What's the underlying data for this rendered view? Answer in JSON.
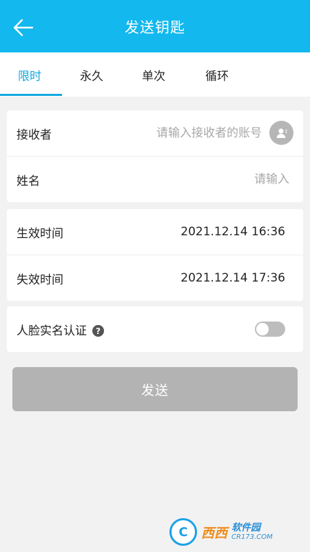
{
  "header": {
    "title": "发送钥匙"
  },
  "tabs": [
    {
      "label": "限时",
      "active": true
    },
    {
      "label": "永久",
      "active": false
    },
    {
      "label": "单次",
      "active": false
    },
    {
      "label": "循环",
      "active": false
    }
  ],
  "form": {
    "receiver": {
      "label": "接收者",
      "value": "",
      "placeholder": "请输入接收者的账号"
    },
    "name": {
      "label": "姓名",
      "value": "",
      "placeholder": "请输入"
    },
    "start_time": {
      "label": "生效时间",
      "value": "2021.12.14 16:36"
    },
    "end_time": {
      "label": "失效时间",
      "value": "2021.12.14 17:36"
    },
    "face_auth": {
      "label": "人脸实名认证",
      "help_icon": "?",
      "enabled": false
    }
  },
  "send_button": {
    "label": "发送"
  },
  "watermark": {
    "logo_letter": "C",
    "main": "西西",
    "sub1": "软件园",
    "sub2": "CR173.COM"
  },
  "colors": {
    "accent": "#12b8ee",
    "active_tab": "#12a8e0",
    "disabled_button": "#b3b3b3"
  }
}
